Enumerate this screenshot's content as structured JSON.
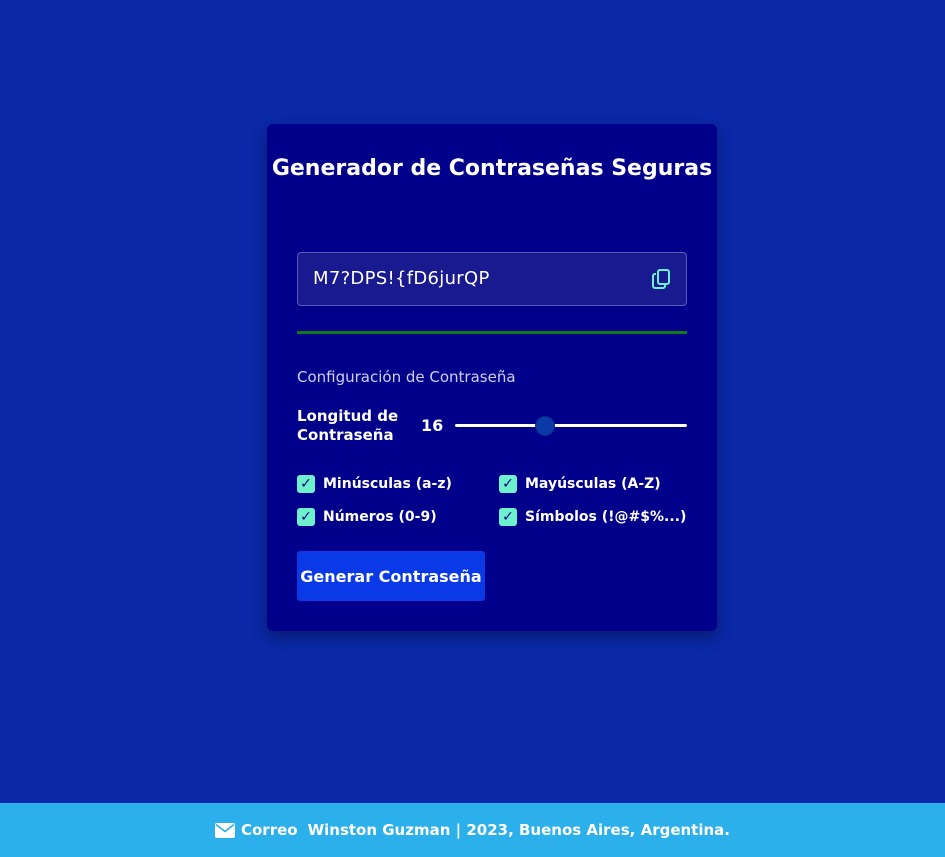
{
  "card": {
    "title": "Generador de Contraseñas Seguras",
    "password": "M7?DPS!{fD6jurQP",
    "copy_icon": "copy-icon",
    "strength_color": "#0d7a16",
    "section_title": "Configuración de Contraseña",
    "length": {
      "label": "Longitud de Contraseña",
      "value": "16",
      "slider_fraction": 0.39
    },
    "options": [
      {
        "label": "Minúsculas (a-z)",
        "checked": true
      },
      {
        "label": "Mayúsculas (A-Z)",
        "checked": true
      },
      {
        "label": "Números (0-9)",
        "checked": true
      },
      {
        "label": "Símbolos (!@#$%...)",
        "checked": true
      }
    ],
    "generate_label": "Generar Contraseña"
  },
  "footer": {
    "mail_icon": "envelope-icon",
    "mail_label": "Correo",
    "credit": "Winston Guzman | 2023, Buenos Aires, Argentina."
  },
  "colors": {
    "background": "#0a28a8",
    "card": "#00008a",
    "accent_check": "#6ff0cc",
    "button": "#0a3ae8",
    "footer": "#2bb0ec"
  }
}
